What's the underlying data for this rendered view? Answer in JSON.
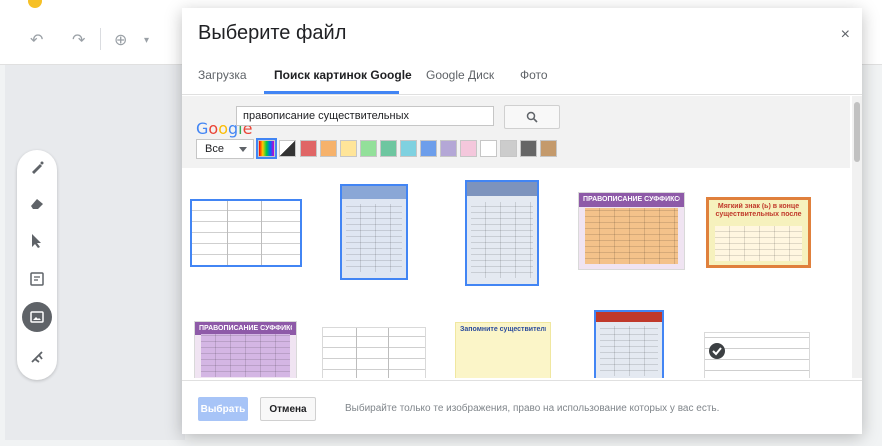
{
  "app": {
    "toolbar_icons": [
      "undo-icon",
      "redo-icon",
      "zoom-icon",
      "chevron-down-icon"
    ]
  },
  "tools": [
    "pen-icon",
    "eraser-icon",
    "select-icon",
    "sticky-note-icon",
    "image-icon",
    "laser-icon"
  ],
  "dialog": {
    "title": "Выберите файл",
    "close_glyph": "×",
    "tabs": [
      {
        "label": "Загрузка",
        "active": false
      },
      {
        "label": "Поиск картинок Google",
        "active": true
      },
      {
        "label": "Google Диск",
        "active": false
      },
      {
        "label": "Фото",
        "active": false
      }
    ],
    "search": {
      "logo": "Google",
      "query": "правописание существительных",
      "type_filter": "Все",
      "swatch_colors": [
        "#e06666",
        "#f6b26b",
        "#ffe599",
        "#93e09a",
        "#6ec6a0",
        "#7fd1e0",
        "#6d9eeb",
        "#b4a7d6",
        "#f4c7dc",
        "#ffffff",
        "#cccccc",
        "#666666",
        "#c49a6c"
      ]
    },
    "results": [
      {
        "caption": ""
      },
      {
        "caption": ""
      },
      {
        "caption": ""
      },
      {
        "caption": "ПРАВОПИСАНИЕ СУФФИКСОВ"
      },
      {
        "caption": "Мягкий знак (ь) в конце существительных после шипящих"
      },
      {
        "caption": "ПРАВОПИСАНИЕ СУФФИКСОВ"
      },
      {
        "caption": ""
      },
      {
        "caption": "Запомните существительные!"
      },
      {
        "caption": ""
      },
      {
        "caption": ""
      }
    ],
    "footer": {
      "select_label": "Выбрать",
      "cancel_label": "Отмена",
      "note": "Выбирайте только те изображения, право на использование которых у вас есть."
    }
  }
}
